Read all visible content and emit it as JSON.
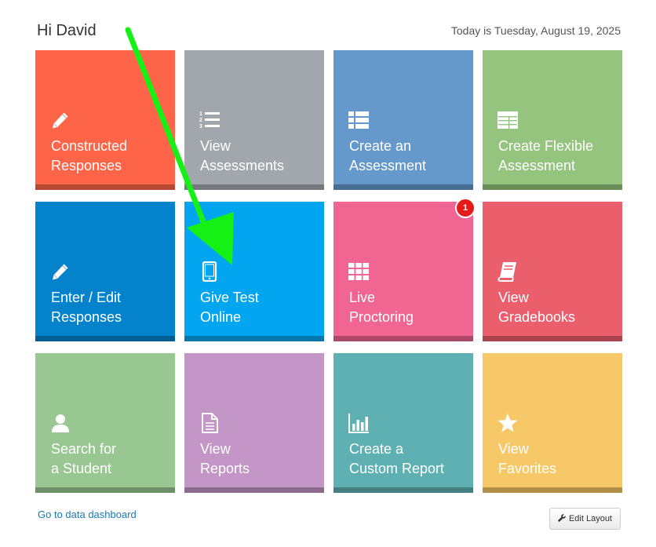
{
  "header": {
    "greeting": "Hi David",
    "date": "Today is Tuesday, August 19, 2025"
  },
  "tiles": [
    {
      "line1": "Constructed",
      "line2": "Responses",
      "icon": "pencil-icon",
      "color": "#fe6548"
    },
    {
      "line1": "View",
      "line2": "Assessments",
      "icon": "numbered-list-icon",
      "color": "#a2a7ad"
    },
    {
      "line1": "Create an",
      "line2": "Assessment",
      "icon": "list-icon",
      "color": "#6598cb"
    },
    {
      "line1": "Create Flexible",
      "line2": "Assessment",
      "icon": "table-icon",
      "color": "#94c47d"
    },
    {
      "line1": "Enter / Edit",
      "line2": "Responses",
      "icon": "pencil-icon",
      "color": "#0483cc"
    },
    {
      "line1": "Give Test",
      "line2": "Online",
      "icon": "tablet-icon",
      "color": "#02a5ef"
    },
    {
      "line1": "Live",
      "line2": "Proctoring",
      "icon": "grid-icon",
      "color": "#f06592",
      "badge": "1"
    },
    {
      "line1": "View",
      "line2": "Gradebooks",
      "icon": "book-icon",
      "color": "#eb5e6c"
    },
    {
      "line1": "Search for",
      "line2": "a Student",
      "icon": "user-icon",
      "color": "#98c792"
    },
    {
      "line1": "View",
      "line2": "Reports",
      "icon": "document-icon",
      "color": "#c495c7"
    },
    {
      "line1": "Create a",
      "line2": "Custom Report",
      "icon": "bar-chart-icon",
      "color": "#5fb0b2"
    },
    {
      "line1": "View",
      "line2": "Favorites",
      "icon": "star-icon",
      "color": "#f7c867"
    }
  ],
  "footer": {
    "dashboard_link": "Go to data dashboard",
    "edit_layout": "Edit Layout"
  },
  "annotation": {
    "arrow_color": "#15f115"
  }
}
